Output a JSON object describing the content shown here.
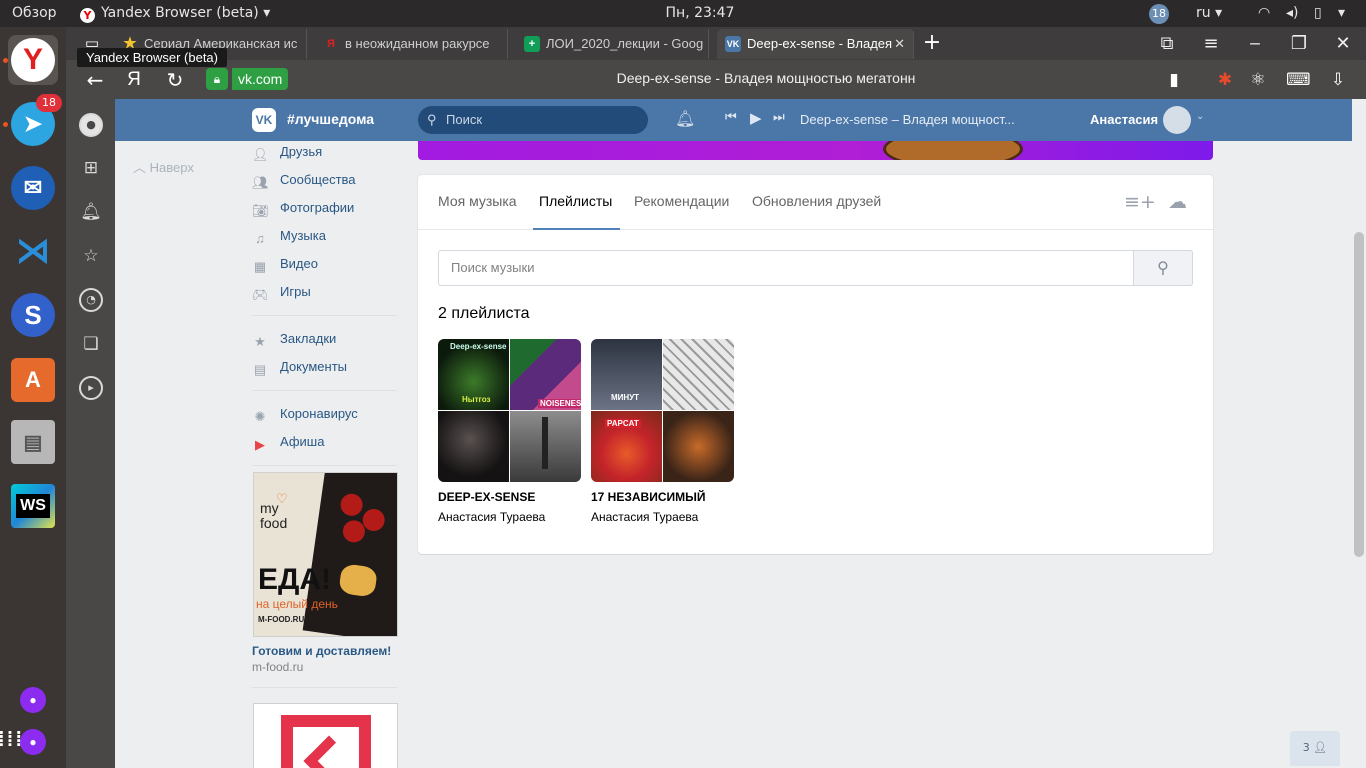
{
  "system": {
    "overview": "Обзор",
    "app_title": "Yandex Browser (beta)",
    "clock": "Пн, 23:47",
    "notif_count": "18",
    "lang": "ru"
  },
  "launcher": {
    "telegram_badge": "18",
    "store_letter": "A",
    "ws_label": "WS"
  },
  "browser": {
    "tabs": [
      {
        "label": "Сериал Американская ис"
      },
      {
        "label": "в неожиданном ракурсе"
      },
      {
        "label": "ЛОИ_2020_лекции - Goog"
      },
      {
        "label": "Deep-ex-sense - Владея"
      }
    ],
    "tooltip": "Yandex Browser (beta)",
    "domain": "vk.com",
    "page_title": "Deep-ex-sense - Владея мощностью мегатонн",
    "ya_button": "Я"
  },
  "vk": {
    "hashtag": "#лучшедома",
    "search_placeholder": "Поиск",
    "now_playing": "Deep-ex-sense – Владея мощност...",
    "user_name": "Анастасия",
    "up_label": "Наверх",
    "nav": [
      {
        "label": "Друзья",
        "icon": "friends-icon"
      },
      {
        "label": "Сообщества",
        "icon": "groups-icon"
      },
      {
        "label": "Фотографии",
        "icon": "camera-icon"
      },
      {
        "label": "Музыка",
        "icon": "music-note-icon"
      },
      {
        "label": "Видео",
        "icon": "film-icon"
      },
      {
        "label": "Игры",
        "icon": "gamepad-icon"
      },
      {
        "label": "Закладки",
        "icon": "star-icon"
      },
      {
        "label": "Документы",
        "icon": "document-icon"
      },
      {
        "label": "Коронавирус",
        "icon": "virus-icon"
      },
      {
        "label": "Афиша",
        "icon": "afisha-icon"
      }
    ],
    "ad": {
      "brand_line1": "my",
      "brand_line2": "food",
      "big_text": "ЕДА!",
      "sub_text": "на целый день",
      "url_text": "M-FOOD.RU",
      "headline": "Готовим и доставляем!",
      "domain": "m-food.ru"
    },
    "music": {
      "tabs": [
        "Моя музыка",
        "Плейлисты",
        "Рекомендации",
        "Обновления друзей"
      ],
      "active_tab": "Плейлисты",
      "search_placeholder": "Поиск музыки",
      "count_label": "2 плейлиста",
      "playlists": [
        {
          "title": "DEEP-EX-SENSE",
          "author": "Анастасия Тураева",
          "cover_texts": [
            "Deep-ex-sense",
            "Нытгоз",
            "NOISENESS"
          ]
        },
        {
          "title": "17 НЕЗАВИСИМЫЙ",
          "author": "Анастасия Тураева",
          "cover_texts": [
            "МИНУТ",
            "PAPCAT"
          ]
        }
      ]
    },
    "online_count": "3"
  }
}
